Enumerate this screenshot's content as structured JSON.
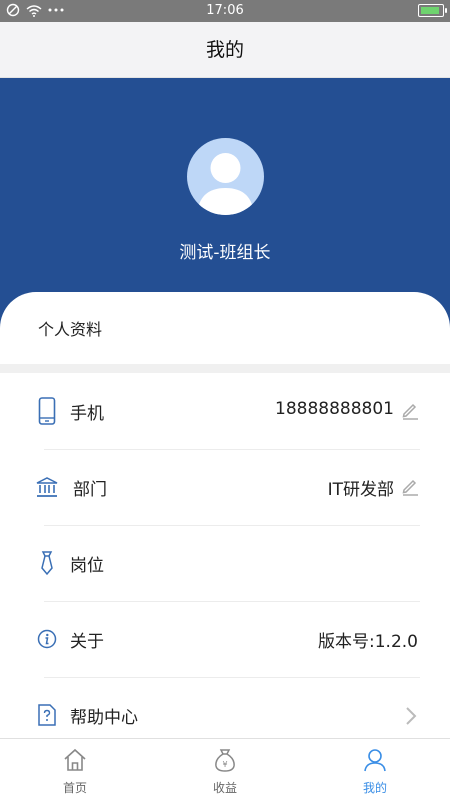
{
  "statusbar": {
    "time": "17:06"
  },
  "header": {
    "title": "我的"
  },
  "profile": {
    "name": "测试-班组长"
  },
  "section": {
    "title": "个人资料"
  },
  "rows": [
    {
      "label": "手机",
      "value": "18888888801",
      "icon": "phone-icon",
      "editable": true
    },
    {
      "label": "部门",
      "value": "IT研发部",
      "icon": "bank-icon",
      "editable": true
    },
    {
      "label": "岗位",
      "value": "",
      "icon": "tie-icon",
      "editable": false
    },
    {
      "label": "关于",
      "value": "版本号:1.2.0",
      "icon": "info-icon",
      "editable": false
    },
    {
      "label": "帮助中心",
      "value": "",
      "icon": "help-document-icon",
      "editable": false
    }
  ],
  "tabs": [
    {
      "label": "首页",
      "icon": "home-icon"
    },
    {
      "label": "收益",
      "icon": "money-bag-icon"
    },
    {
      "label": "我的",
      "icon": "user-icon",
      "active": true
    }
  ],
  "colors": {
    "brand_blue": "#244f93",
    "avatar_bg": "#bed7f7",
    "active_tab": "#3a8ee6"
  }
}
